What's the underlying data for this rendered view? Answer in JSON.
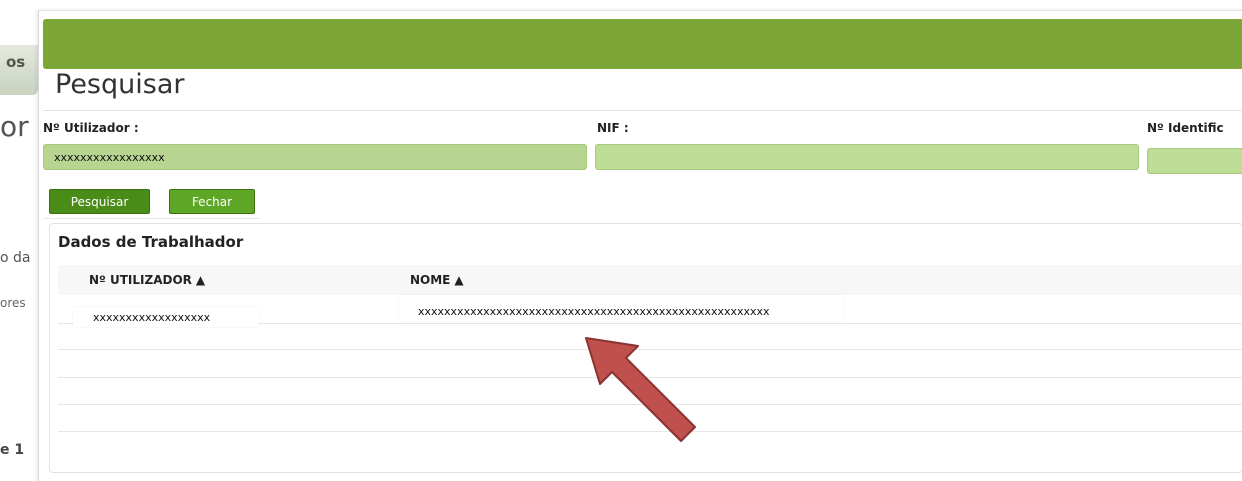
{
  "background": {
    "tab_label": "os",
    "heading": "or",
    "text1": "o da",
    "text2": "ores",
    "text3": "e 1"
  },
  "dialog": {
    "title": "Pesquisar",
    "fields": [
      {
        "label": "Nº Utilizador :",
        "value": "xxxxxxxxxxxxxxxxx"
      },
      {
        "label": "NIF :",
        "value": ""
      },
      {
        "label": "Nº Identific",
        "value": ""
      }
    ],
    "buttons": {
      "search": "Pesquisar",
      "close": "Fechar"
    },
    "results": {
      "title": "Dados de Trabalhador",
      "columns": [
        {
          "label": "Nº UTILIZADOR",
          "sort_icon": "sort-icon"
        },
        {
          "label": "NOME",
          "sort_icon": "sort-icon"
        }
      ],
      "rows": [
        {
          "utilizador": "xxxxxxxxxxxxxxxxxx",
          "nome": "xxxxxxxxxxxxxxxxxxxxxxxxxxxxxxxxxxxxxxxxxxxxxxxxxxxxxx"
        }
      ]
    }
  },
  "colors": {
    "topbar": "#7ca636",
    "field": "#bedd97",
    "button": "#4a8c18",
    "arrow": "#c0504d"
  }
}
